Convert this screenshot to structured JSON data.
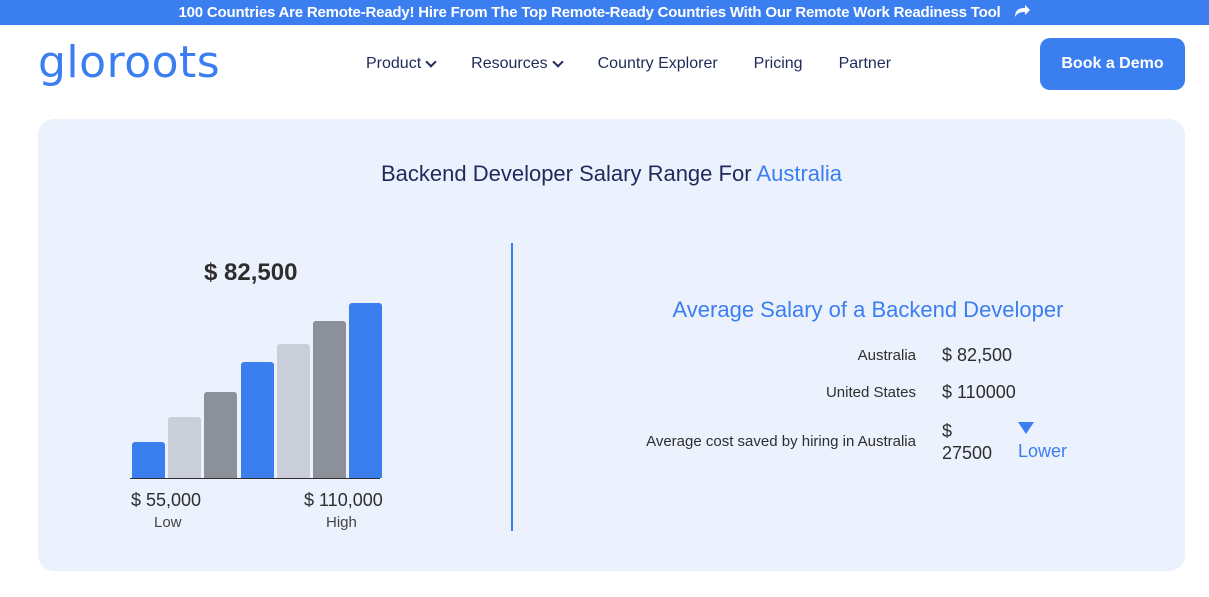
{
  "banner": {
    "text": "100 Countries Are Remote-Ready! Hire From The Top Remote-Ready Countries With Our Remote Work Readiness Tool",
    "icon": "share-arrow-icon"
  },
  "nav": {
    "logo": "gloroots",
    "items": [
      {
        "label": "Product",
        "dropdown": true
      },
      {
        "label": "Resources",
        "dropdown": true
      },
      {
        "label": "Country Explorer",
        "dropdown": false
      },
      {
        "label": "Pricing",
        "dropdown": false
      },
      {
        "label": "Partner",
        "dropdown": false
      }
    ],
    "cta": "Book a Demo"
  },
  "section": {
    "title_prefix": "Backend Developer Salary Range For",
    "title_country": "Australia"
  },
  "chart_data": {
    "type": "bar",
    "values": [
      20,
      34,
      48,
      65,
      75,
      88,
      98
    ],
    "colors": [
      "#3b7ef0",
      "#c9ced8",
      "#8c9099",
      "#3b7ef0",
      "#c9ced8",
      "#8c9099",
      "#3b7ef0"
    ],
    "average_label": "$ 82,500",
    "low_value": "$ 55,000",
    "low_label": "Low",
    "high_value": "$ 110,000",
    "high_label": "High"
  },
  "comparison": {
    "heading": "Average Salary of a Backend Developer",
    "rows": [
      {
        "label": "Australia",
        "value": "$ 82,500"
      },
      {
        "label": "United States",
        "value": "$ 110000"
      }
    ],
    "saved_label": "Average cost saved by hiring in Australia",
    "saved_value_line1": "$",
    "saved_value_line2": "27500",
    "saved_tag": "Lower"
  },
  "colors": {
    "accent": "#3b7ef0",
    "panel_bg": "#ebf2fd",
    "text_dark": "#1f2a5a"
  }
}
